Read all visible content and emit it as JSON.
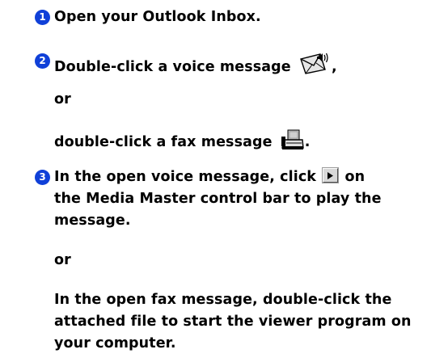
{
  "steps": [
    {
      "number": "1",
      "text": "Open your Outlook Inbox."
    },
    {
      "number": "2",
      "text_before_icon": "Double-click a voice message",
      "voice_icon": "voice-message-icon",
      "text_after_icon": ",",
      "or_label": "or",
      "alt_text_before_icon": "double-click a fax message",
      "fax_icon": "fax-message-icon",
      "alt_text_after_icon": "."
    },
    {
      "number": "3",
      "line1_before_icon": "In the open voice message, click",
      "play_icon": "play-icon",
      "line1_after_icon": "on",
      "line2": "the Media Master control bar to play the",
      "line3": "message.",
      "or_label": "or",
      "alt_line1": "In the open fax message, double-click the",
      "alt_line2": "attached file to start the viewer program on",
      "alt_line3": "your computer."
    }
  ],
  "colors": {
    "step_badge": "#1040d8",
    "text": "#000000"
  }
}
